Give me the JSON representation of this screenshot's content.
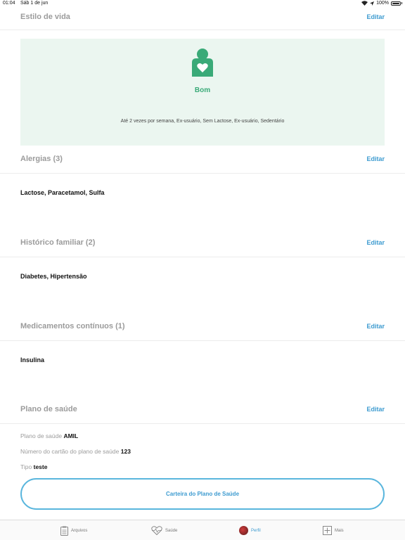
{
  "status_bar": {
    "time": "01:04",
    "date": "Sáb 1 de jun",
    "battery": "100%"
  },
  "lifestyle": {
    "title": "Estilo de vida",
    "edit": "Editar",
    "status": "Bom",
    "details": "Até 2 vezes por semana, Ex-usuário, Sem Lactose, Ex-usuário, Sedentário",
    "icon": "person-heart-icon",
    "accent": "#3aaa78",
    "card_bg": "#ebf6f0"
  },
  "allergies": {
    "title": "Alergias (3)",
    "edit": "Editar",
    "value": "Lactose, Paracetamol, Sulfa"
  },
  "family_history": {
    "title": "Histórico familiar (2)",
    "edit": "Editar",
    "value": "Diabetes, Hipertensão"
  },
  "medications": {
    "title": "Medicamentos contínuos (1)",
    "edit": "Editar",
    "value": "Insulina"
  },
  "health_plan": {
    "title": "Plano de saúde",
    "edit": "Editar",
    "plan_label": "Plano de saúde",
    "plan_value": "AMIL",
    "card_number_label": "Número do cartão do plano de saúde",
    "card_number_value": "123",
    "type_label": "Tipo",
    "type_value": "teste",
    "card_button": "Carteira do Plano de Saúde"
  },
  "tabbar": {
    "files": "Arquivos",
    "health": "Saúde",
    "profile": "Perfil",
    "more": "Mais"
  },
  "colors": {
    "link": "#3d9bd0",
    "muted": "#9b9b9b",
    "button_border": "#5ab6dd"
  }
}
